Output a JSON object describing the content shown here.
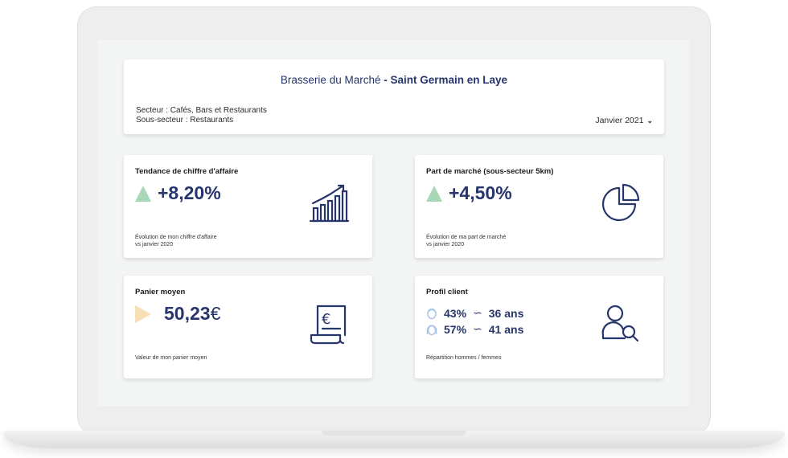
{
  "header": {
    "venue": "Brasserie du Marché",
    "location": "- Saint Germain en Laye",
    "sector": "Secteur : Cafés, Bars et Restaurants",
    "subsector": "Sous-secteur :  Restaurants",
    "period": "Janvier 2021"
  },
  "kpis": {
    "revenue": {
      "title": "Tendance de chiffre d'affaire",
      "value": "+8,20%",
      "note_1": "Évolution de mon chiffre d'affaire",
      "note_2": "vs janvier 2020",
      "icon": "growth-bar-chart-icon"
    },
    "market_share": {
      "title": "Part de marché (sous-secteur 5km)",
      "value": "+4,50%",
      "note_1": "Évolution de ma part de marché",
      "note_2": "vs janvier 2020",
      "icon": "pie-chart-icon"
    },
    "basket": {
      "title": "Panier moyen",
      "value": "50,23",
      "currency": "€",
      "note": "Valeur de mon panier moyen",
      "icon": "euro-receipt-icon"
    },
    "profile": {
      "title": "Profil client",
      "men_pct": "43%",
      "men_age": "36 ans",
      "women_pct": "57%",
      "women_age": "41 ans",
      "approx": "∽",
      "note": "Répartition hommes / femmes",
      "icon": "user-search-icon"
    }
  },
  "colors": {
    "navy": "#26356b",
    "trend_up": "#a8d8b8",
    "trend_flat": "#f8dfb5",
    "gender_icon": "#a9c6e8"
  }
}
